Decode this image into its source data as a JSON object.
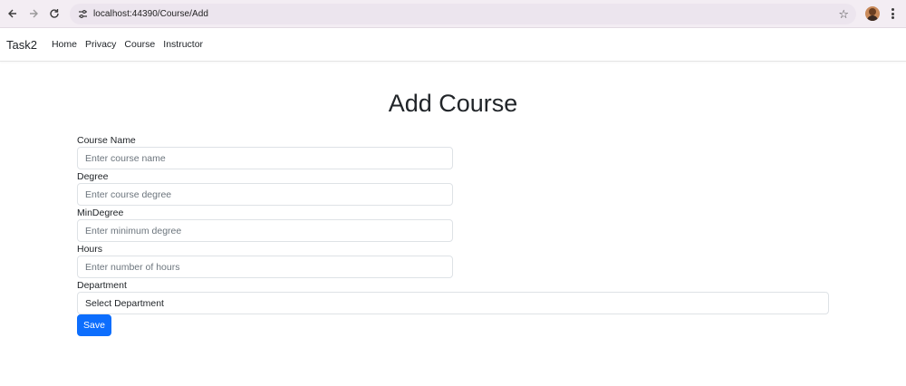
{
  "browser": {
    "url": "localhost:44390/Course/Add",
    "icons": [
      "back-icon",
      "forward-icon",
      "reload-icon",
      "site-settings-icon",
      "bookmark-star-icon",
      "profile-avatar",
      "more-menu-icon"
    ]
  },
  "navbar": {
    "brand": "Task2",
    "links": [
      "Home",
      "Privacy",
      "Course",
      "Instructor"
    ]
  },
  "form": {
    "title": "Add Course",
    "fields": [
      {
        "label": "Course Name",
        "placeholder": "Enter course name"
      },
      {
        "label": "Degree",
        "placeholder": "Enter course degree"
      },
      {
        "label": "MinDegree",
        "placeholder": "Enter minimum degree"
      },
      {
        "label": "Hours",
        "placeholder": "Enter number of hours"
      }
    ],
    "department": {
      "label": "Department",
      "selected": "Select Department"
    },
    "save_label": "Save"
  },
  "colors": {
    "primary": "#0d6efd",
    "chrome_bg": "#f3edf3"
  }
}
